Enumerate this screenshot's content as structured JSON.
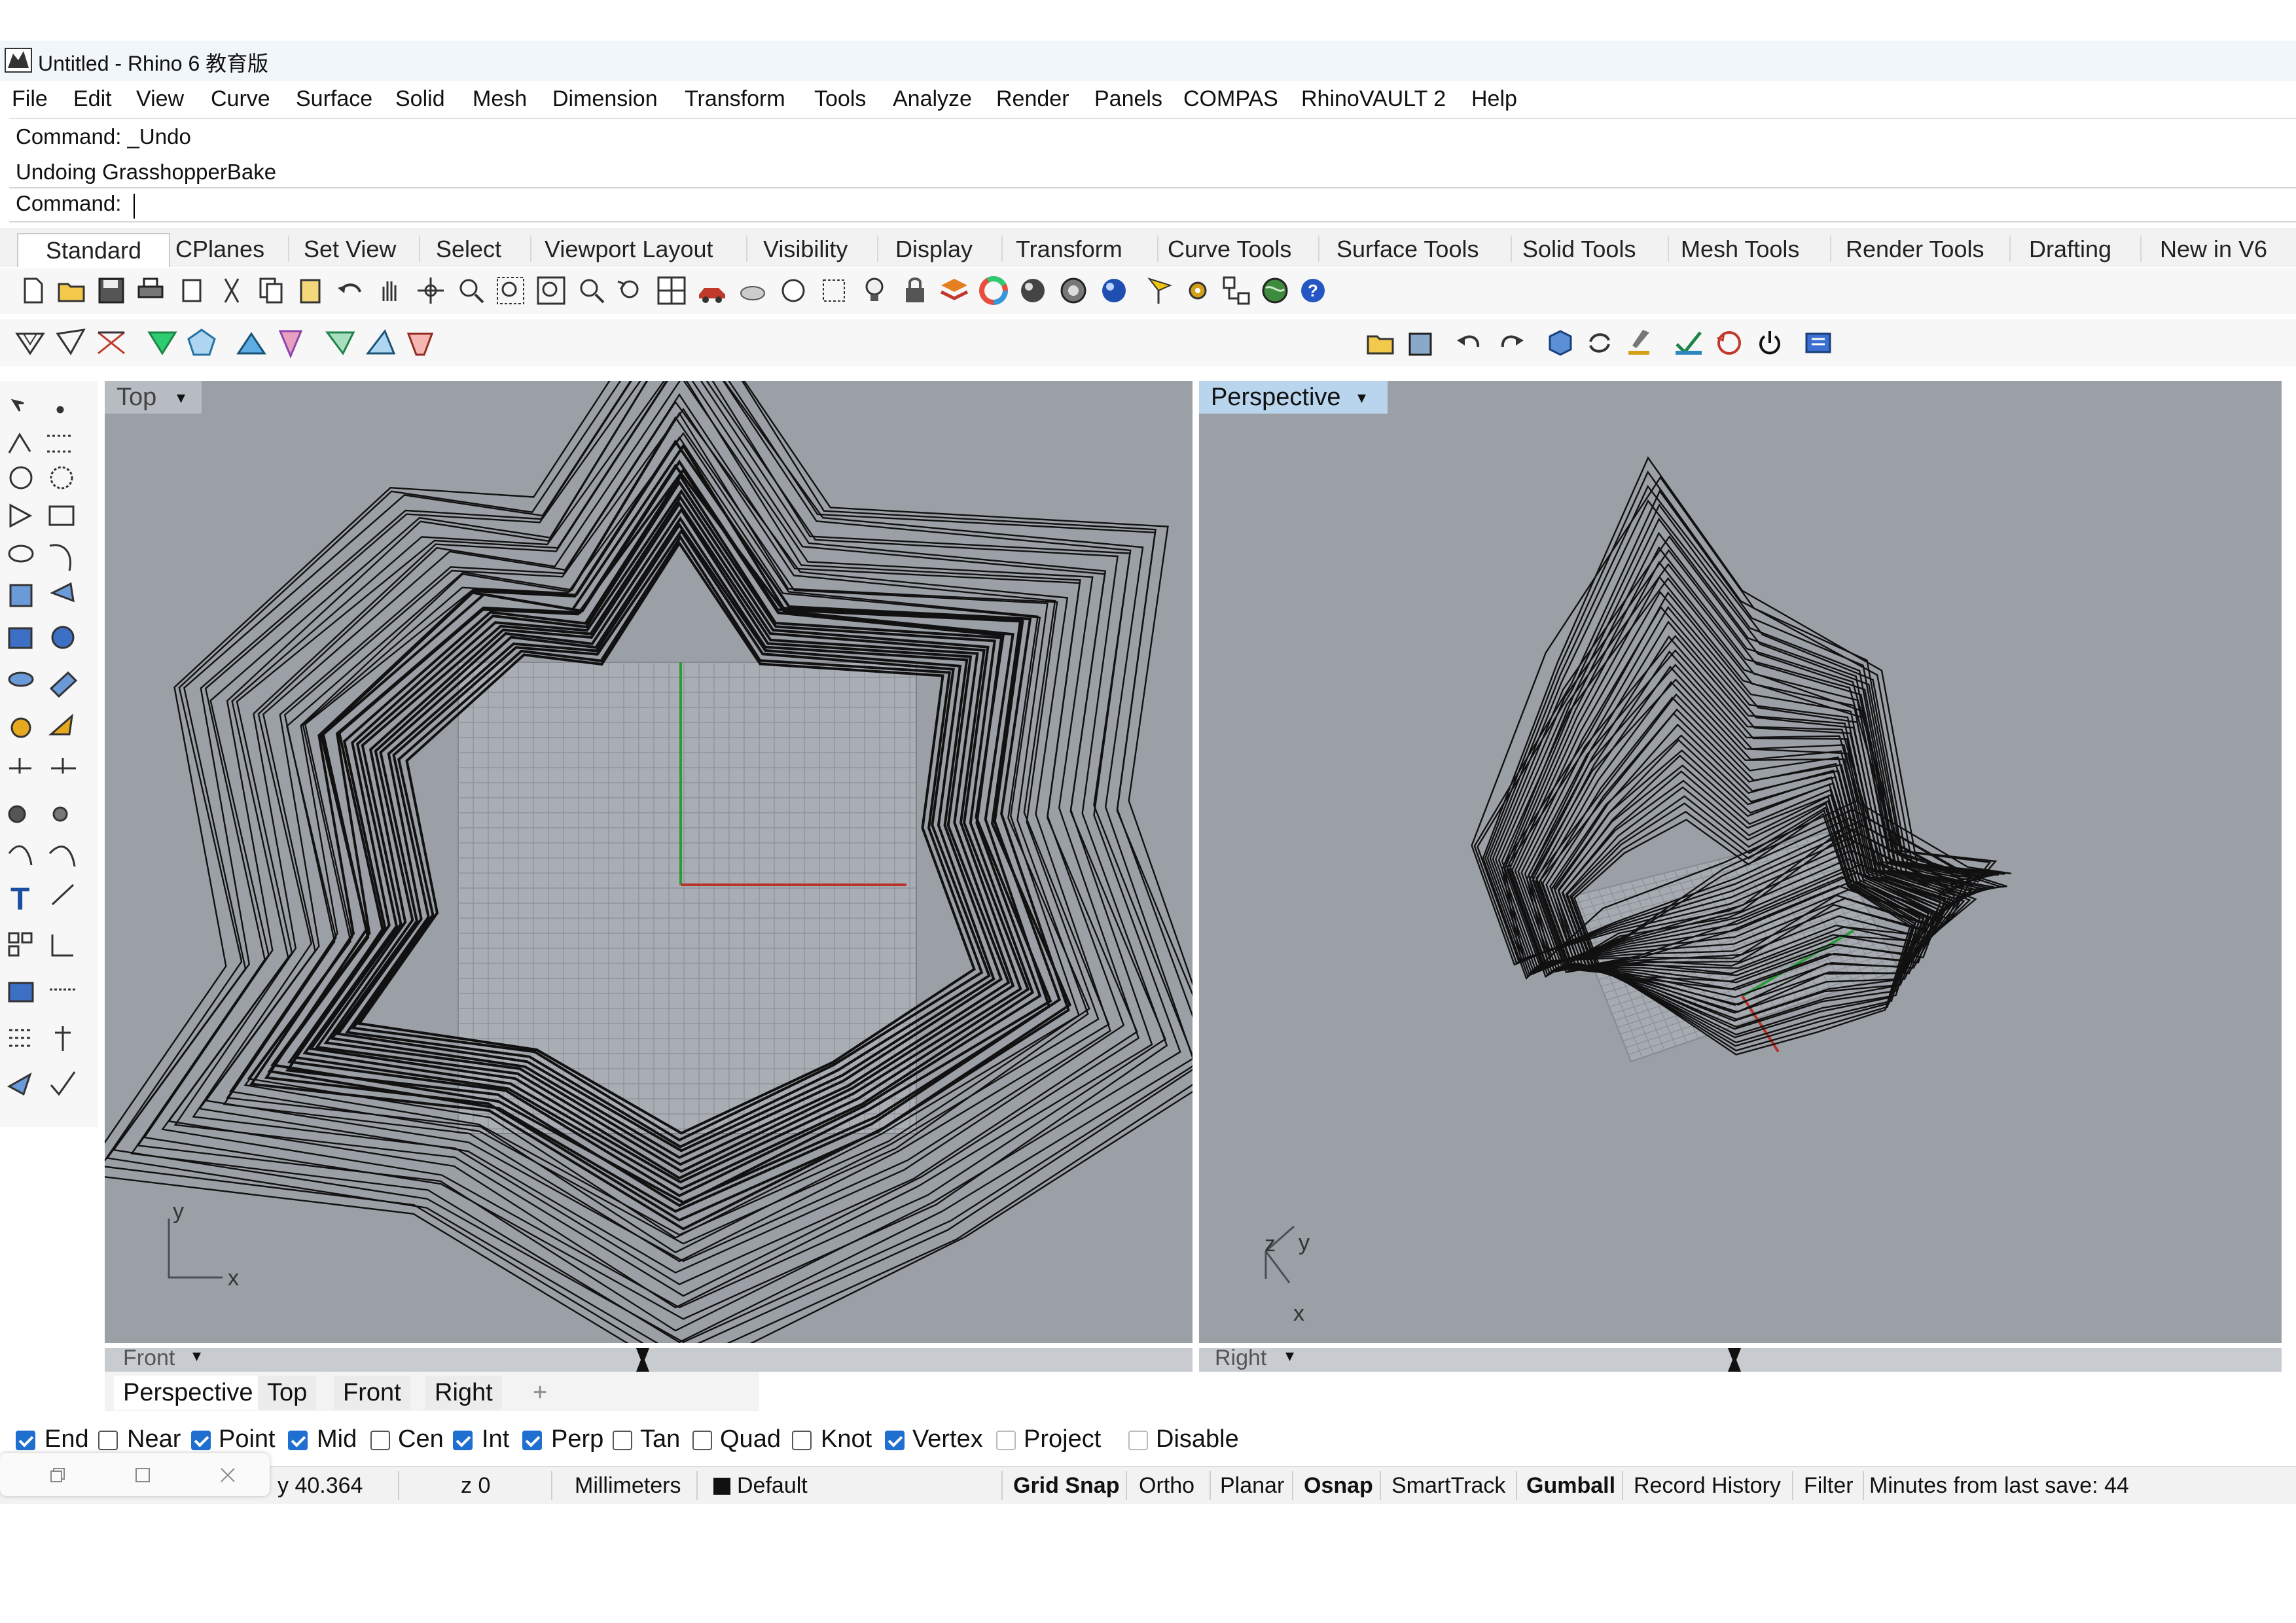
{
  "window": {
    "title": "Untitled - Rhino 6 教育版"
  },
  "menu": [
    "File",
    "Edit",
    "View",
    "Curve",
    "Surface",
    "Solid",
    "Mesh",
    "Dimension",
    "Transform",
    "Tools",
    "Analyze",
    "Render",
    "Panels",
    "COMPAS",
    "RhinoVAULT 2",
    "Help"
  ],
  "command": {
    "history": [
      "Command: _Undo",
      "Undoing GrasshopperBake"
    ],
    "prompt": "Command:"
  },
  "toolbar_tabs": [
    "Standard",
    "CPlanes",
    "Set View",
    "Select",
    "Viewport Layout",
    "Visibility",
    "Display",
    "Transform",
    "Curve Tools",
    "Surface Tools",
    "Solid Tools",
    "Mesh Tools",
    "Render Tools",
    "Drafting",
    "New in V6"
  ],
  "active_tab": "Standard",
  "viewports": {
    "top": {
      "label": "Top",
      "axis_x": "x",
      "axis_y": "y",
      "collapsed": "Front"
    },
    "perspective": {
      "label": "Perspective",
      "axis_x": "x",
      "axis_y": "y",
      "axis_z": "z",
      "collapsed": "Right"
    }
  },
  "viewport_tabs": [
    "Perspective",
    "Top",
    "Front",
    "Right"
  ],
  "add_tab": "+",
  "osnaps": [
    {
      "label": "End",
      "checked": true
    },
    {
      "label": "Near",
      "checked": false
    },
    {
      "label": "Point",
      "checked": true
    },
    {
      "label": "Mid",
      "checked": true
    },
    {
      "label": "Cen",
      "checked": false
    },
    {
      "label": "Int",
      "checked": true
    },
    {
      "label": "Perp",
      "checked": true
    },
    {
      "label": "Tan",
      "checked": false
    },
    {
      "label": "Quad",
      "checked": false
    },
    {
      "label": "Knot",
      "checked": false
    },
    {
      "label": "Vertex",
      "checked": true
    },
    {
      "label": "Project",
      "checked": false
    },
    {
      "label": "Disable",
      "checked": false
    }
  ],
  "status": {
    "y": "y 40.364",
    "z": "z 0",
    "units": "Millimeters",
    "layer": "Default",
    "grid_snap": "Grid Snap",
    "ortho": "Ortho",
    "planar": "Planar",
    "osnap": "Osnap",
    "smarttrack": "SmartTrack",
    "gumball": "Gumball",
    "record_history": "Record History",
    "filter": "Filter",
    "last_save": "Minutes from last save: 44"
  },
  "colors": {
    "viewport_bg": "#9ba0a6",
    "active_viewport_label": "#b9d5ee",
    "x_axis": "#c0392b",
    "y_axis": "#27a34a",
    "checkbox": "#1f6fd0"
  },
  "icons": [
    "rhino-logo-icon",
    "new-icon",
    "open-icon",
    "save-icon",
    "print-icon",
    "import-icon",
    "cut-icon",
    "copy-icon",
    "paste-icon",
    "undo-icon",
    "pan-icon",
    "rotate-view-icon",
    "zoom-icon",
    "zoom-window-icon",
    "zoom-extents-icon",
    "zoom-selected-icon",
    "undo-view-icon",
    "four-viewports-icon",
    "car-icon",
    "sphere-icon",
    "light-icon",
    "lock-icon",
    "layers-icon",
    "color-wheel-icon",
    "render-sphere-icon",
    "material-icon",
    "environment-icon",
    "gear-icon",
    "help-icon"
  ]
}
